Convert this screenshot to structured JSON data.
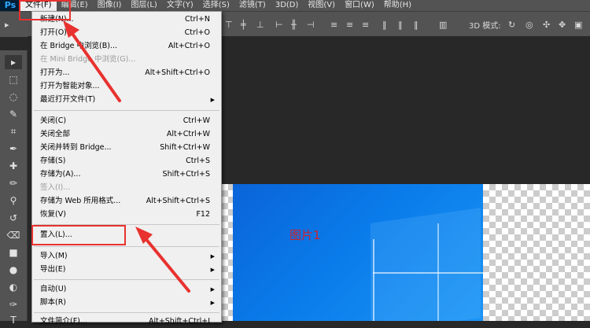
{
  "app": {
    "logo": "Ps"
  },
  "menubar": {
    "items": [
      "文件(F)",
      "编辑(E)",
      "图像(I)",
      "图层(L)",
      "文字(Y)",
      "选择(S)",
      "滤镜(T)",
      "3D(D)",
      "视图(V)",
      "窗口(W)",
      "帮助(H)"
    ]
  },
  "optionsbar": {
    "mode_3d": "3D 模式:"
  },
  "file_menu": {
    "items": [
      {
        "label": "新建(N)...",
        "shortcut": "Ctrl+N"
      },
      {
        "label": "打开(O)...",
        "shortcut": "Ctrl+O"
      },
      {
        "label": "在 Bridge 中浏览(B)...",
        "shortcut": "Alt+Ctrl+O"
      },
      {
        "label": "在 Mini Bridge 中浏览(G)...",
        "shortcut": ""
      },
      {
        "label": "打开为...",
        "shortcut": "Alt+Shift+Ctrl+O"
      },
      {
        "label": "打开为智能对象...",
        "shortcut": ""
      },
      {
        "label": "最近打开文件(T)",
        "shortcut": ""
      },
      {
        "label": "关闭(C)",
        "shortcut": "Ctrl+W"
      },
      {
        "label": "关闭全部",
        "shortcut": "Alt+Ctrl+W"
      },
      {
        "label": "关闭并转到 Bridge...",
        "shortcut": "Shift+Ctrl+W"
      },
      {
        "label": "存储(S)",
        "shortcut": "Ctrl+S"
      },
      {
        "label": "存储为(A)...",
        "shortcut": "Shift+Ctrl+S"
      },
      {
        "label": "签入(I)...",
        "shortcut": ""
      },
      {
        "label": "存储为 Web 所用格式...",
        "shortcut": "Alt+Shift+Ctrl+S"
      },
      {
        "label": "恢复(V)",
        "shortcut": "F12"
      },
      {
        "label": "置入(L)...",
        "shortcut": ""
      },
      {
        "label": "导入(M)",
        "shortcut": ""
      },
      {
        "label": "导出(E)",
        "shortcut": ""
      },
      {
        "label": "自动(U)",
        "shortcut": ""
      },
      {
        "label": "脚本(R)",
        "shortcut": ""
      },
      {
        "label": "文件简介(F)...",
        "shortcut": "Alt+Shift+Ctrl+I"
      }
    ]
  },
  "canvas": {
    "image_text": "图片1"
  },
  "colors": {
    "highlight": "#e8322f",
    "accent": "#31a8ff"
  }
}
